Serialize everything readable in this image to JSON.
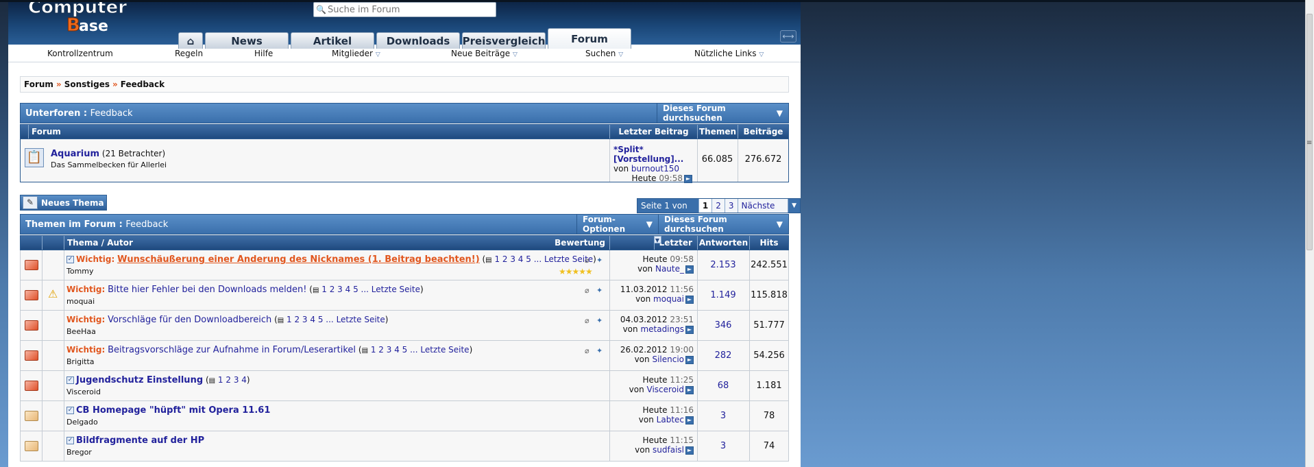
{
  "header": {
    "logo_text_1": "Computer",
    "logo_text_2": "Base",
    "search_placeholder": "Suche im Forum",
    "tabs": [
      {
        "label": "⌂",
        "name": "home"
      },
      {
        "label": "News",
        "name": "news"
      },
      {
        "label": "Artikel",
        "name": "artikel"
      },
      {
        "label": "Downloads",
        "name": "downloads"
      },
      {
        "label": "Preisvergleich",
        "name": "preisvergleich"
      },
      {
        "label": "Forum",
        "name": "forum"
      }
    ]
  },
  "subnav": {
    "items": [
      "Kontrollzentrum",
      "Regeln",
      "Hilfe",
      "Mitglieder",
      "Neue Beiträge",
      "Suchen",
      "Nützliche Links"
    ]
  },
  "breadcrumb": [
    "Forum",
    "Sonstiges",
    "Feedback"
  ],
  "subforums": {
    "title": "Unterforen",
    "title_sub": "Feedback",
    "search_btn": "Dieses Forum durchsuchen",
    "columns": [
      "Forum",
      "Letzter Beitrag",
      "Themen",
      "Beiträge"
    ],
    "forum_name": "Aquarium",
    "forum_viewers": "(21 Betrachter)",
    "forum_desc": "Das Sammelbecken für Allerlei",
    "last_title": "*Split* [Vorstellung]...",
    "last_by_prefix": "von",
    "last_by": "burnout150",
    "last_date": "Heute",
    "last_time": "09:58",
    "themen": "66.085",
    "beitraege": "276.672"
  },
  "actions": {
    "new_thread": "Neues Thema",
    "page_info": "Seite 1 von 3",
    "pages": [
      "1",
      "2",
      "3"
    ],
    "next": "Nächste >"
  },
  "threads": {
    "title": "Themen im Forum",
    "title_sub": "Feedback",
    "options_btn": "Forum-Optionen",
    "search_btn": "Dieses Forum durchsuchen",
    "columns": [
      "Thema / Autor",
      "Bewertung",
      "Letzter Beitrag",
      "Antworten",
      "Hits"
    ],
    "rows": [
      {
        "prefix": "Wichtig:",
        "title": "Wunschäußerung einer Änderung des Nicknames (1. Beitrag beachten!)",
        "pages": "1 2 3 4 5 ...",
        "last_page": "Letzte Seite",
        "author": "Tommy",
        "date": "Heute",
        "time": "09:58",
        "by": "Naute_",
        "replies": "2.153",
        "hits": "242.551"
      },
      {
        "prefix": "Wichtig:",
        "title": "Bitte hier Fehler bei den Downloads melden!",
        "pages": "1 2 3 4 5 ...",
        "last_page": "Letzte Seite",
        "author": "moquai",
        "date": "11.03.2012",
        "time": "11:56",
        "by": "moquai",
        "replies": "1.149",
        "hits": "115.818"
      },
      {
        "prefix": "Wichtig:",
        "title": "Vorschläge für den Downloadbereich",
        "pages": "1 2 3 4 5 ...",
        "last_page": "Letzte Seite",
        "author": "BeeHaa",
        "date": "04.03.2012",
        "time": "23:51",
        "by": "metadings",
        "replies": "346",
        "hits": "51.777"
      },
      {
        "prefix": "Wichtig:",
        "title": "Beitragsvorschläge zur Aufnahme in Forum/Leserartikel",
        "pages": "1 2 3 4 5 ...",
        "last_page": "Letzte Seite",
        "author": "Brigitta",
        "date": "26.02.2012",
        "time": "19:00",
        "by": "Silencio",
        "replies": "282",
        "hits": "54.256"
      },
      {
        "prefix": "",
        "title": "Jugendschutz Einstellung",
        "pages": "1 2 3 4",
        "last_page": "",
        "author": "Visceroid",
        "date": "Heute",
        "time": "11:25",
        "by": "Visceroid",
        "replies": "68",
        "hits": "1.181"
      },
      {
        "prefix": "",
        "title": "CB Homepage \"hüpft\" mit Opera 11.61",
        "pages": "",
        "last_page": "",
        "author": "Delgado",
        "date": "Heute",
        "time": "11:16",
        "by": "Labtec",
        "replies": "3",
        "hits": "78"
      },
      {
        "prefix": "",
        "title": "Bildfragmente auf der HP",
        "pages": "",
        "last_page": "",
        "author": "Bregor",
        "date": "Heute",
        "time": "11:15",
        "by": "sudfaisl",
        "replies": "3",
        "hits": "74"
      }
    ]
  },
  "colors": {
    "accent": "#3a6fab",
    "important": "#e1571f",
    "link": "#22229c"
  }
}
